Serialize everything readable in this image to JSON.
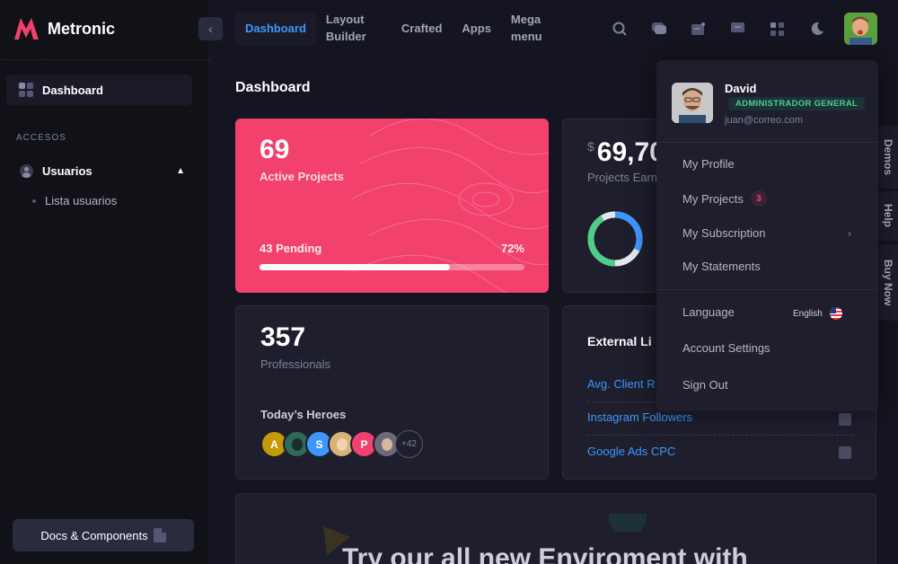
{
  "brand": {
    "name": "Metronic",
    "accent": "#f1416c"
  },
  "sidebar": {
    "dashboard_label": "Dashboard",
    "section_title": "ACCESOS",
    "usuarios_label": "Usuarios",
    "submenu": [
      "Lista usuarios"
    ],
    "docs_label": "Docs & Components"
  },
  "nav": {
    "items": [
      "Dashboard",
      "Layout Builder",
      "Crafted",
      "Apps",
      "Mega menu"
    ],
    "active": "Dashboard"
  },
  "page": {
    "title": "Dashboard"
  },
  "cards": {
    "active_projects": {
      "value": "69",
      "label": "Active Projects",
      "pending": "43 Pending",
      "percent_text": "72%",
      "progress": 72
    },
    "earnings": {
      "currency": "$",
      "value": "69,70",
      "label": "Projects Earn"
    },
    "professionals": {
      "value": "357",
      "label": "Professionals",
      "heroes_title": "Today’s Heroes",
      "heroes": [
        "A",
        "",
        "S",
        "",
        "P",
        "",
        "+42"
      ]
    },
    "external": {
      "title": "External Li",
      "links": [
        "Avg. Client R",
        "Instagram Followers",
        "Google Ads CPC"
      ]
    },
    "banner": {
      "text": "Try our all new Enviroment with"
    }
  },
  "side_tabs": [
    "Demos",
    "Help",
    "Buy Now"
  ],
  "dropdown": {
    "name": "David",
    "role": "ADMINISTRADOR GENERAL",
    "email": "juan@correo.com",
    "items": {
      "profile": "My Profile",
      "projects": "My Projects",
      "projects_count": "3",
      "subscription": "My Subscription",
      "statements": "My Statements",
      "language": "Language",
      "language_value": "English",
      "settings": "Account Settings",
      "signout": "Sign Out"
    }
  }
}
